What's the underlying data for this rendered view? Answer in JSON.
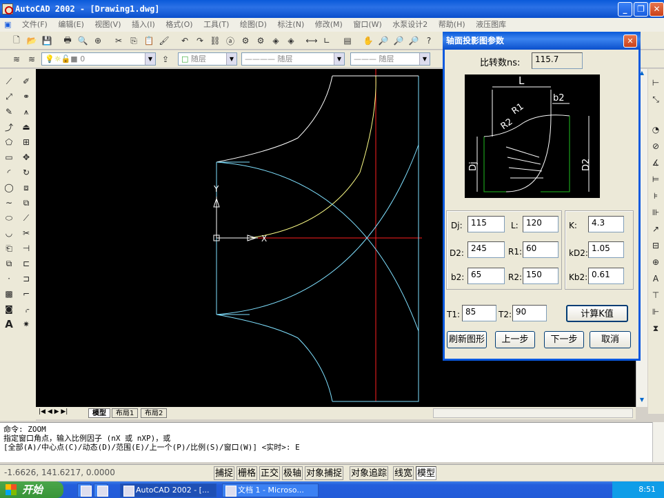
{
  "window": {
    "title": "AutoCAD 2002 - [Drawing1.dwg]",
    "min_icon": "minimize-icon",
    "max_icon": "restore-icon",
    "close_icon": "close-icon"
  },
  "menu": {
    "items": [
      "文件(F)",
      "编辑(E)",
      "视图(V)",
      "插入(I)",
      "格式(O)",
      "工具(T)",
      "绘图(D)",
      "标注(N)",
      "修改(M)",
      "窗口(W)",
      "水泵设计2",
      "帮助(H)",
      "液压图库"
    ]
  },
  "layers": {
    "current": "0",
    "color": "随层",
    "linetype": "随层",
    "lineweight": "随层"
  },
  "tabs": [
    "模型",
    "布局1",
    "布局2"
  ],
  "command": {
    "lines": [
      "命令: ZOOM",
      "指定窗口角点，输入比例因子 (nX 或 nXP)，或",
      "[全部(A)/中心点(C)/动态(D)/范围(E)/上一个(P)/比例(S)/窗口(W)] <实时>: E"
    ]
  },
  "status": {
    "coords": "-1.6626, 141.6217, 0.0000",
    "toggles": [
      "捕捉",
      "栅格",
      "正交",
      "极轴",
      "对象捕捉",
      "对象追踪",
      "线宽",
      "模型"
    ]
  },
  "taskbar": {
    "start": "开始",
    "tasks": [
      "AutoCAD 2002 - [...",
      "文档 1 - Microso..."
    ],
    "clock": "8:51"
  },
  "ucs": {
    "x": "X",
    "y": "Y"
  },
  "dialog": {
    "title": "轴面投影图参数",
    "ratio_label": "比转数ns:",
    "ratio_value": "115.7",
    "preview_labels": {
      "L": "L",
      "b2": "b2",
      "R1": "R1",
      "R2": "R2",
      "Dj": "Dj",
      "D2": "D2"
    },
    "fields": [
      {
        "label": "Dj:",
        "value": "115"
      },
      {
        "label": "L:",
        "value": "120"
      },
      {
        "label": "D2:",
        "value": "245"
      },
      {
        "label": "R1:",
        "value": "60"
      },
      {
        "label": "b2:",
        "value": "65"
      },
      {
        "label": "R2:",
        "value": "150"
      }
    ],
    "k_fields": [
      {
        "label": "K:",
        "value": "4.3"
      },
      {
        "label": "kD2:",
        "value": "1.05"
      },
      {
        "label": "Kb2:",
        "value": "0.61"
      }
    ],
    "t1_label": "T1:",
    "t1_value": "85",
    "t2_label": "T2:",
    "t2_value": "90",
    "calc_button": "计算K值",
    "buttons": [
      "刷新图形",
      "上一步",
      "下一步",
      "取消"
    ]
  },
  "colors": {
    "title_blue": "#0a5ad9",
    "canvas": "#000000",
    "white_line": "#ffffff",
    "cyan_line": "#7fe0ff",
    "red_line": "#ff2020",
    "green_line": "#20c020"
  }
}
